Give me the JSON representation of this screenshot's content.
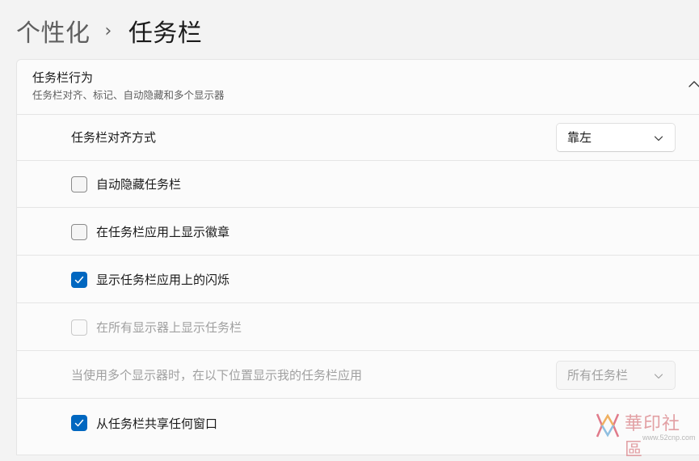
{
  "breadcrumb": {
    "parent": "个性化",
    "separator": "›",
    "current": "任务栏"
  },
  "section": {
    "title": "任务栏行为",
    "subtitle": "任务栏对齐、标记、自动隐藏和多个显示器",
    "collapse_icon": "chevron-up-icon"
  },
  "alignment": {
    "label": "任务栏对齐方式",
    "value": "靠左"
  },
  "options": [
    {
      "label": "自动隐藏任务栏",
      "checked": false,
      "enabled": true
    },
    {
      "label": "在任务栏应用上显示徽章",
      "checked": false,
      "enabled": true
    },
    {
      "label": "显示任务栏应用上的闪烁",
      "checked": true,
      "enabled": true
    },
    {
      "label": "在所有显示器上显示任务栏",
      "checked": false,
      "enabled": false
    }
  ],
  "multi_display": {
    "label": "当使用多个显示器时，在以下位置显示我的任务栏应用",
    "value": "所有任务栏",
    "enabled": false
  },
  "share": {
    "label": "从任务栏共享任何窗口",
    "checked": true
  },
  "watermark": {
    "text": "華印社區",
    "sub": "www.52cnp.com"
  },
  "colors": {
    "accent": "#0067c0",
    "background": "#f3f3f3",
    "card": "#fbfbfb"
  }
}
